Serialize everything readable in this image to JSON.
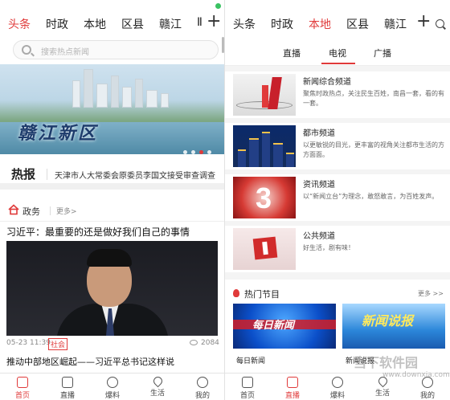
{
  "left": {
    "nav": {
      "tabs": [
        "头条",
        "时政",
        "本地",
        "区县",
        "赣江",
        "Ⅱ"
      ],
      "active": 0
    },
    "search_placeholder": "搜索热点新闻",
    "banner_caption": "赣江新区",
    "hot": {
      "title": "热报",
      "text": "天津市人大常委会原委员李国文接受审查调查"
    },
    "section": {
      "name": "政务",
      "more": "更多>"
    },
    "article": {
      "title": "习近平：最重要的还是做好我们自己的事情",
      "date": "05-23 11:39",
      "tag": "社会",
      "views": "2084"
    },
    "article2_title": "推动中部地区崛起——习近平总书记这样说",
    "bottom_nav": [
      "首页",
      "直播",
      "爆料",
      "生活",
      "我的"
    ],
    "bottom_active": 0
  },
  "right": {
    "nav": {
      "tabs": [
        "头条",
        "时政",
        "本地",
        "区县",
        "赣江"
      ],
      "active": 2
    },
    "subtabs": [
      "直播",
      "电视",
      "广播"
    ],
    "subtab_active": 1,
    "channels": [
      {
        "name": "新闻综合频道",
        "desc": "聚焦时政热点，关注民生百姓，南昌一套，看的有一套。"
      },
      {
        "name": "都市频道",
        "desc": "以更敏锐的目光，更丰富的视角关注都市生活的方方面面。"
      },
      {
        "name": "资讯频道",
        "desc": "以“新闻立台”为理念，敢怒敢言，为百姓发声。"
      },
      {
        "name": "公共频道",
        "desc": "好生活，剧有味！"
      }
    ],
    "hot_programs": {
      "title": "热门节目",
      "more": "更多 >>",
      "items": [
        {
          "name": "每日新闻",
          "logo_text": "每日新闻"
        },
        {
          "name": "新闻说报",
          "logo_text": "新闻说报"
        }
      ]
    },
    "bottom_nav": [
      "首页",
      "直播",
      "爆料",
      "生活",
      "我的"
    ],
    "bottom_active": 1,
    "watermark": "当下软件园",
    "watermark_url": "www.downxia.com"
  },
  "colors": {
    "accent": "#e03a3a"
  }
}
